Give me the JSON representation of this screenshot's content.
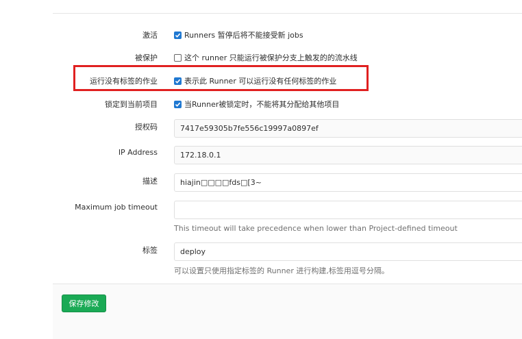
{
  "form": {
    "active": {
      "label": "激活",
      "checked": true,
      "text": "Runners 暂停后将不能接受新 jobs"
    },
    "protected": {
      "label": "被保护",
      "checked": false,
      "text": "这个 runner 只能运行被保护分支上触发的的流水线"
    },
    "run_untagged": {
      "label": "运行没有标签的作业",
      "checked": true,
      "text": "表示此 Runner 可以运行没有任何标签的作业"
    },
    "locked": {
      "label": "锁定到当前项目",
      "checked": true,
      "text": "当Runner被锁定时，不能将其分配给其他项目"
    },
    "token": {
      "label": "授权码",
      "value": "7417e59305b7fe556c19997a0897ef"
    },
    "ip_address": {
      "label": "IP Address",
      "value": "172.18.0.1"
    },
    "description": {
      "label": "描述",
      "value": "hiajin□□□□fds□[3~"
    },
    "max_timeout": {
      "label": "Maximum job timeout",
      "value": "",
      "help": "This timeout will take precedence when lower than Project-defined timeout"
    },
    "tags": {
      "label": "标签",
      "value": "deploy",
      "help": "可以设置只使用指定标签的 Runner 进行构建,标签用逗号分隔。"
    }
  },
  "footer": {
    "save_label": "保存修改"
  },
  "colors": {
    "highlight": "#e02020",
    "checkbox": "#1f78d1",
    "save_button": "#1aaa55"
  }
}
